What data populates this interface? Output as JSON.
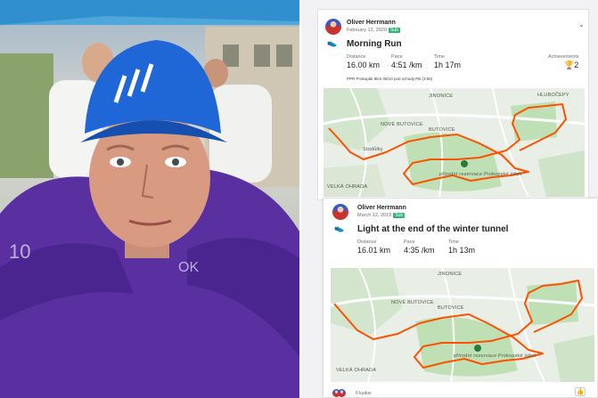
{
  "activities": [
    {
      "athlete": "Oliver Herrmann",
      "date": "February 13, 2020",
      "badge": "Sub",
      "title": "Morning Run",
      "stats": [
        {
          "label": "Distance",
          "value": "16.00 km"
        },
        {
          "label": "Pace",
          "value": "4:51 /km"
        },
        {
          "label": "Time",
          "value": "1h 17m"
        }
      ],
      "achievements_label": "Achievements",
      "achievements_value": "2",
      "note": "PPR Prokopák 8km 06/10 pod schody PB (3:56)",
      "map_labels": [
        "NOVÉ BUTOVICE",
        "JINONICE",
        "BUTOVICE",
        "HLUBOČEPY",
        "přírodní rezervace Prokopské údolí",
        "Stodůlky",
        "VELKÁ OHRADA"
      ]
    },
    {
      "athlete": "Oliver Herrmann",
      "date": "March 12, 2019",
      "badge": "Sub",
      "title": "Light at the end of the winter tunnel",
      "stats": [
        {
          "label": "Distance",
          "value": "16.01 km"
        },
        {
          "label": "Pace",
          "value": "4:35 /km"
        },
        {
          "label": "Time",
          "value": "1h 13m"
        }
      ],
      "map_labels": [
        "NOVÉ BUTOVICE",
        "JINONICE",
        "BUTOVICE",
        "přírodní rezervace Prokopské údolí",
        "VELKÁ OHRADA"
      ],
      "kudos": "6 kudos"
    }
  ],
  "colors": {
    "route": "#fc5200",
    "map_green": "#bfe0b5",
    "badge": "#2bb673",
    "jacket": "#5a2fa0",
    "cap": "#1f66d6"
  },
  "icons": [
    "shoe-icon",
    "trophy-icon",
    "chevron-down-icon",
    "thumbs-up-icon"
  ]
}
